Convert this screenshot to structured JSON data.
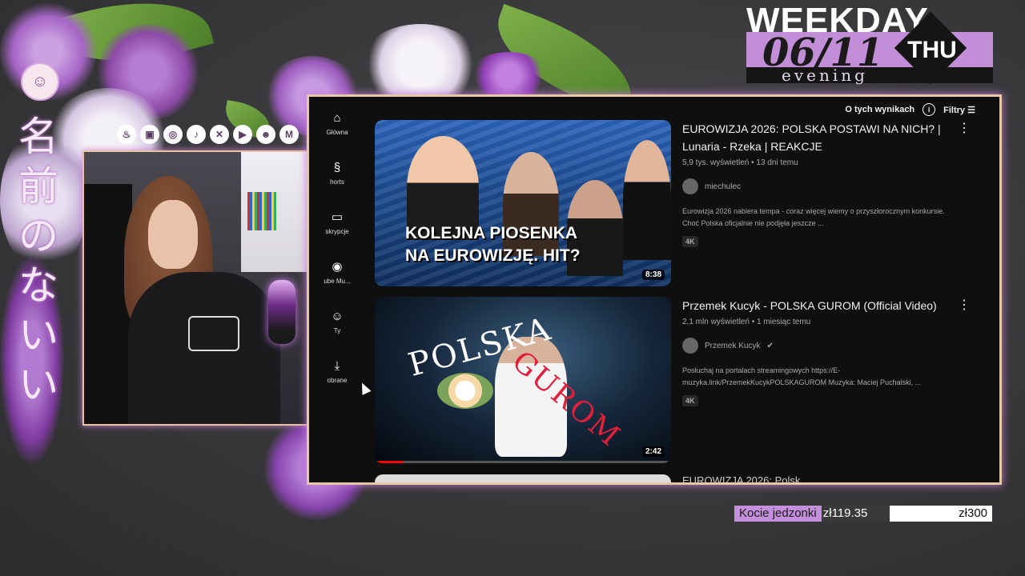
{
  "colors": {
    "accent": "#c48fdc",
    "frame": "#e6c8a4",
    "yt_bg": "#0f0f0f"
  },
  "overlay": {
    "vertical_text": [
      "名",
      "前",
      "の",
      "な",
      "い",
      "い"
    ],
    "socials": [
      "kofi-icon",
      "twitch-icon",
      "instagram-icon",
      "tiktok-icon",
      "x-icon",
      "youtube-icon",
      "discord-icon",
      "gmail-icon"
    ],
    "weekday": {
      "title": "WEEKDAY",
      "date": "06/11",
      "day": "THU",
      "period": "evening"
    },
    "goal": {
      "label": "Kocie jedzonki",
      "current": "zł119.35",
      "target": "zł300",
      "progress": 0.398
    }
  },
  "youtube": {
    "sidebar": [
      {
        "icon": "home-icon",
        "label": "Główna"
      },
      {
        "icon": "shorts-icon",
        "label": "horts"
      },
      {
        "icon": "subscriptions-icon",
        "label": "skrypcje"
      },
      {
        "icon": "youtube-music-icon",
        "label": "ube Mu..."
      },
      {
        "icon": "you-icon",
        "label": "Ty"
      },
      {
        "icon": "downloads-icon",
        "label": "obrane"
      }
    ],
    "topbar": {
      "about": "O tych wynikach",
      "filters": "Filtry"
    },
    "results": [
      {
        "thumb_caption_1": "KOLEJNA PIOSENKA",
        "thumb_caption_2": "NA EUROWIZJĘ. HIT?",
        "duration": "8:38",
        "title": "EUROWIZJA 2026: POLSKA POSTAWI NA NICH? | Lunaria - Rzeka | REAKCJE",
        "meta": "5,9 tys. wyświetleń • 13 dni temu",
        "channel": "miechulec",
        "desc": "Eurowizja 2026 nabiera tempa - coraz więcej wiemy o przyszłorocznym konkursie. Choć Polska oficjalnie nie podjęła jeszcze ...",
        "badge": "4K"
      },
      {
        "thumb_text_1": "POLSKA",
        "thumb_text_2": "GUROM",
        "duration": "2:42",
        "title": "Przemek Kucyk - POLSKA GUROM (Official Video)",
        "meta": "2,1 mln wyświetleń • 1 miesiąc temu",
        "channel": "Przemek Kucyk",
        "desc": "Posłuchaj na portalach streamingowych https://E-muzyka.link/PrzemekKucykPOLSKAGUROM Muzyka: Maciej Puchalski, ...",
        "badge": "4K"
      }
    ],
    "third_title_partial": "EUROWIZJA 2026: Polsk..."
  }
}
